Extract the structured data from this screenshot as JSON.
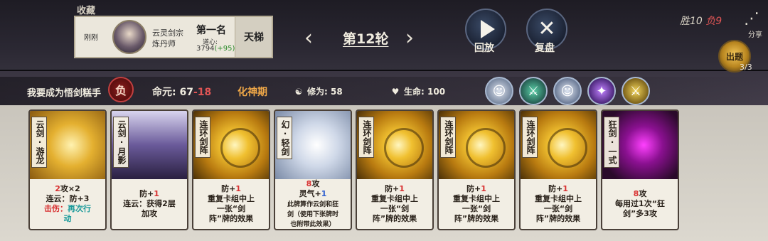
{
  "top": {
    "favorite_label": "收藏",
    "player_panel": {
      "left_text": "刚刚",
      "sect_line1": "云灵剑宗",
      "sect_line2": "炼丹师",
      "rank": "第一名",
      "daoxin_label": "道心:",
      "daoxin_value": "3794",
      "daoxin_delta": "(+95)",
      "ladder_label": "天梯"
    },
    "round": {
      "prev_icon": "‹",
      "title": "第12轮",
      "next_icon": "›"
    },
    "buttons": {
      "play_label": "回放",
      "replay_label": "复盘"
    },
    "record": {
      "win_label": "胜10",
      "loss_label": "负9"
    },
    "share_label": "分享",
    "chuti": {
      "label": "出题",
      "count": "3/3"
    }
  },
  "info": {
    "player_name": "我要成为悟剑糕手",
    "result_badge": "负",
    "destiny_label": "命元:",
    "destiny_value": "67",
    "destiny_delta": "-18",
    "realm": "化神期",
    "cultivation_label": "修为:",
    "cultivation_value": "58",
    "life_label": "生命:",
    "life_value": "100",
    "character_icons": [
      "character-portrait-icon",
      "jade-sword-icon",
      "character-portrait-icon",
      "purple-orb-icon",
      "golden-sword-icon"
    ]
  },
  "cards": [
    {
      "title": "云剑·游龙",
      "art": "dragon",
      "lines": [
        [
          {
            "t": "2",
            "c": "red"
          },
          {
            "t": "攻×2",
            "c": ""
          }
        ],
        [
          {
            "t": "连云：防+3",
            "c": ""
          }
        ],
        [
          {
            "t": "击伤：",
            "c": "red"
          },
          {
            "t": "再次行",
            "c": "teal"
          }
        ],
        [
          {
            "t": "动",
            "c": "teal"
          }
        ]
      ]
    },
    {
      "title": "云剑·月影",
      "art": "moon",
      "lines": [
        [
          {
            "t": "防+",
            "c": ""
          },
          {
            "t": "1",
            "c": "red"
          }
        ],
        [
          {
            "t": "连云：获得2层",
            "c": ""
          }
        ],
        [
          {
            "t": "加攻",
            "c": ""
          }
        ]
      ]
    },
    {
      "title": "连环剑阵",
      "art": "gold",
      "lines": [
        [
          {
            "t": "防+",
            "c": ""
          },
          {
            "t": "1",
            "c": "red"
          }
        ],
        [
          {
            "t": "重复卡组中上",
            "c": ""
          }
        ],
        [
          {
            "t": "一张“剑",
            "c": ""
          }
        ],
        [
          {
            "t": "阵”牌的效果",
            "c": ""
          }
        ]
      ]
    },
    {
      "title": "幻·轻剑",
      "art": "sword",
      "lines": [
        [
          {
            "t": "8",
            "c": "red"
          },
          {
            "t": "攻",
            "c": ""
          }
        ],
        [
          {
            "t": "灵气+",
            "c": ""
          },
          {
            "t": "1",
            "c": "blue"
          }
        ],
        [
          {
            "t": "此牌算作云剑和狂",
            "c": "small"
          }
        ],
        [
          {
            "t": "剑（使用下张牌时",
            "c": "small"
          }
        ],
        [
          {
            "t": "也附带此效果）",
            "c": "small"
          }
        ]
      ]
    },
    {
      "title": "连环剑阵",
      "art": "gold",
      "lines": [
        [
          {
            "t": "防+",
            "c": ""
          },
          {
            "t": "1",
            "c": "red"
          }
        ],
        [
          {
            "t": "重复卡组中上",
            "c": ""
          }
        ],
        [
          {
            "t": "一张“剑",
            "c": ""
          }
        ],
        [
          {
            "t": "阵”牌的效果",
            "c": ""
          }
        ]
      ]
    },
    {
      "title": "连环剑阵",
      "art": "gold",
      "lines": [
        [
          {
            "t": "防+",
            "c": ""
          },
          {
            "t": "1",
            "c": "red"
          }
        ],
        [
          {
            "t": "重复卡组中上",
            "c": ""
          }
        ],
        [
          {
            "t": "一张“剑",
            "c": ""
          }
        ],
        [
          {
            "t": "阵”牌的效果",
            "c": ""
          }
        ]
      ]
    },
    {
      "title": "连环剑阵",
      "art": "gold",
      "lines": [
        [
          {
            "t": "防+",
            "c": ""
          },
          {
            "t": "1",
            "c": "red"
          }
        ],
        [
          {
            "t": "重复卡组中上",
            "c": ""
          }
        ],
        [
          {
            "t": "一张“剑",
            "c": ""
          }
        ],
        [
          {
            "t": "阵”牌的效果",
            "c": ""
          }
        ]
      ]
    },
    {
      "title": "狂剑·一式",
      "art": "purple",
      "lines": [
        [
          {
            "t": "8",
            "c": "red"
          },
          {
            "t": "攻",
            "c": ""
          }
        ],
        [
          {
            "t": "每用过1次“狂",
            "c": ""
          }
        ],
        [
          {
            "t": "剑”多3攻",
            "c": ""
          }
        ]
      ]
    }
  ],
  "colors": {
    "loss_red": "#e05555",
    "realm_orange": "#f0a848",
    "delta_green": "#2a8a2a"
  }
}
